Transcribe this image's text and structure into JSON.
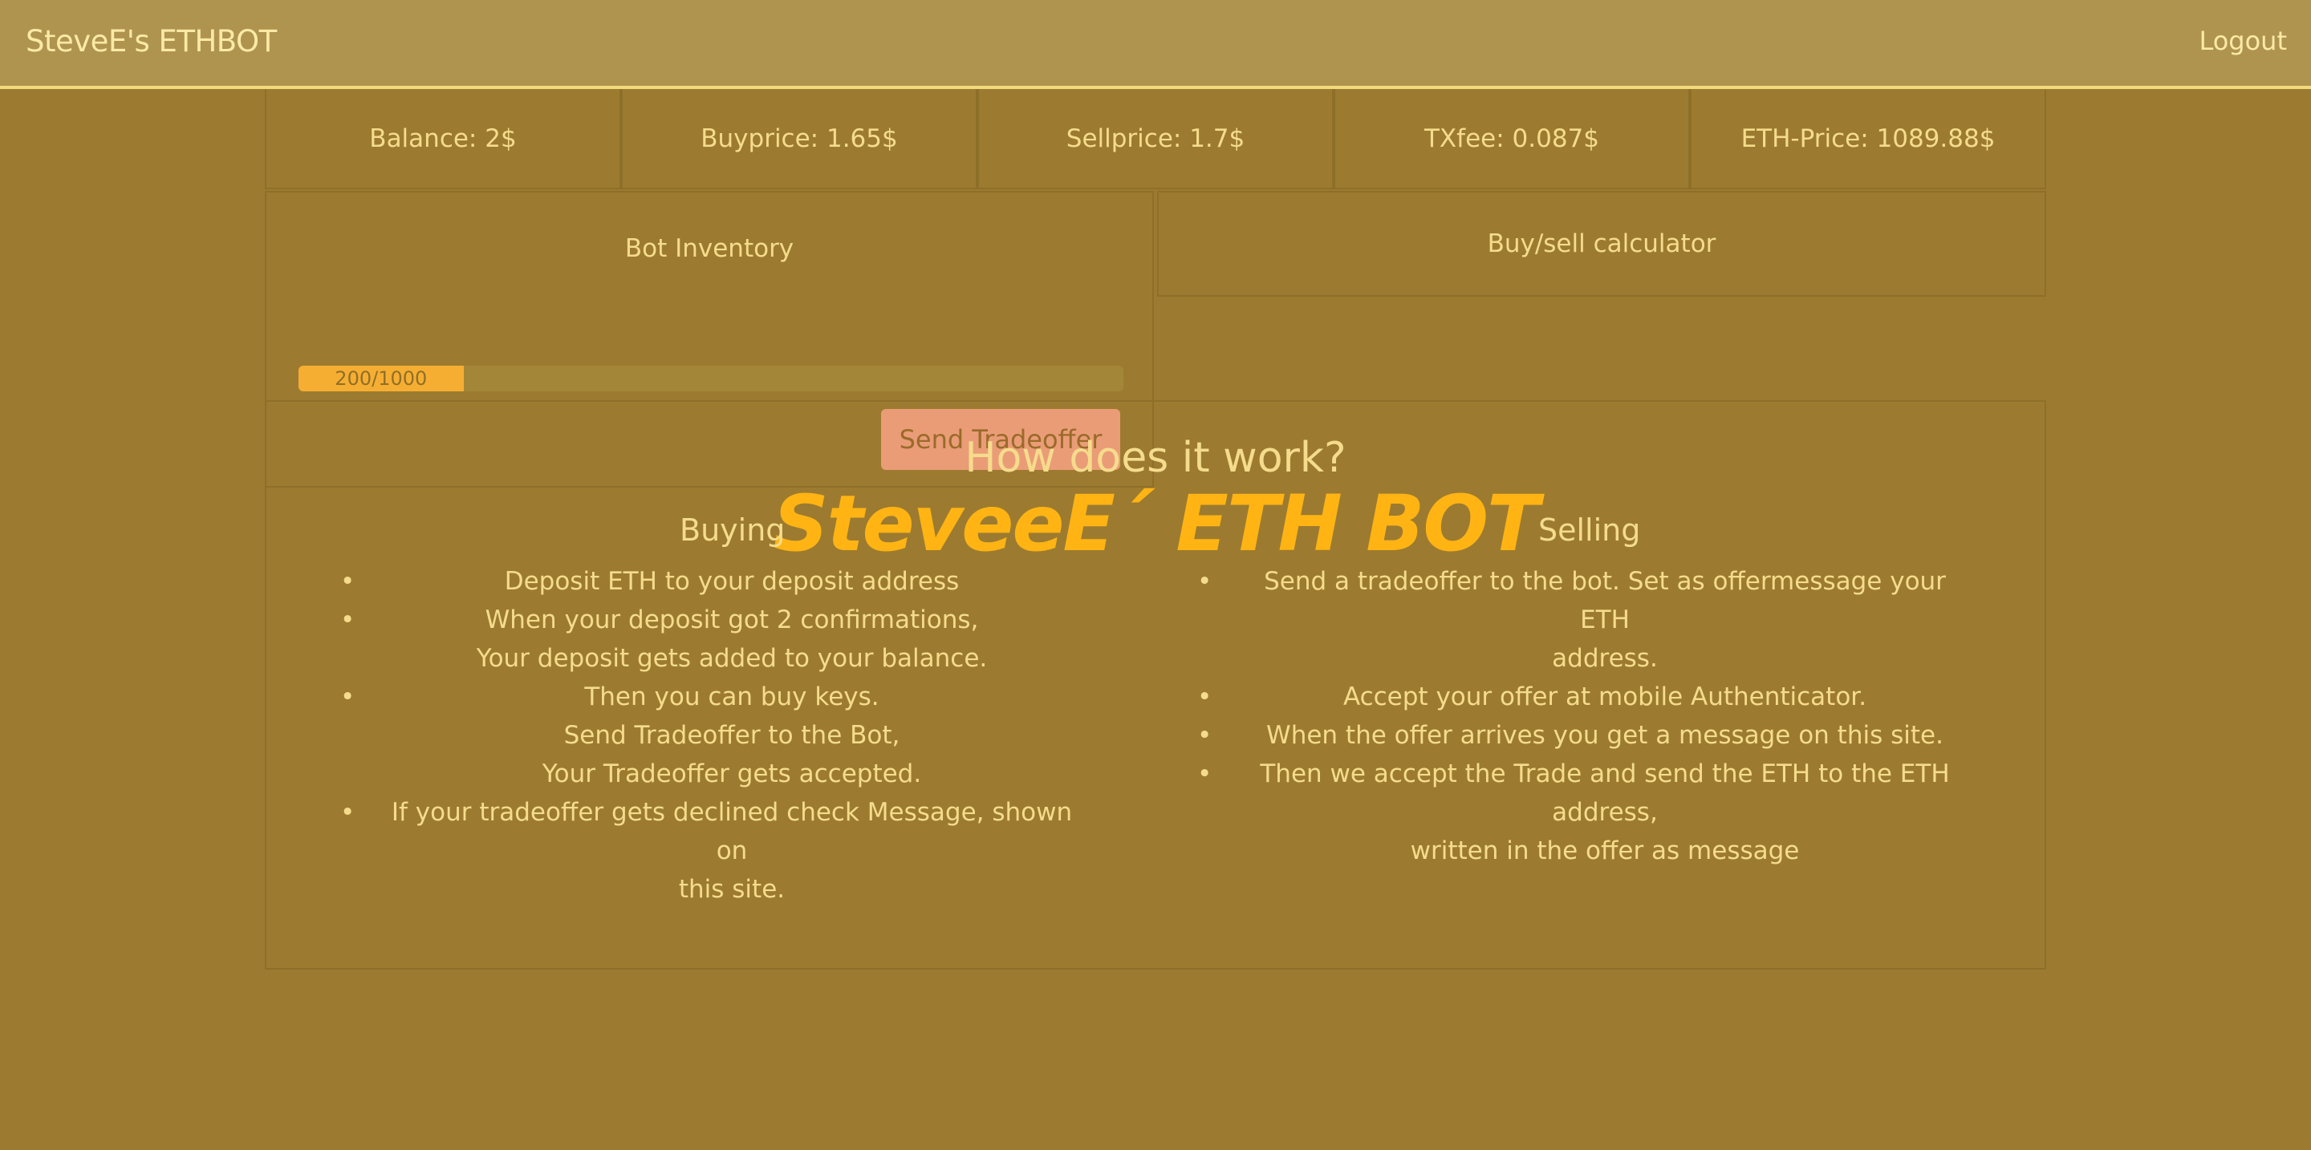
{
  "navbar": {
    "brand": "SteveE's ETHBOT",
    "logout": "Logout"
  },
  "stats": [
    {
      "label": "Balance: 2$"
    },
    {
      "label": "Buyprice: 1.65$"
    },
    {
      "label": "Sellprice: 1.7$"
    },
    {
      "label": "TXfee: 0.087$"
    },
    {
      "label": "ETH-Price: 1089.88$"
    }
  ],
  "inventory": {
    "title": "Bot Inventory",
    "progress_text": "200/1000",
    "progress_fraction": 0.2,
    "send_button": "Send Tradeoffer"
  },
  "calculator": {
    "title": "Buy/sell calculator"
  },
  "how": {
    "title": "How does it work?",
    "logo_text": "SteveeE´ ETH BOT",
    "buying_title": "Buying",
    "selling_title": "Selling",
    "buying_items": [
      [
        "Deposit ETH to your deposit address"
      ],
      [
        "When your deposit got 2 confirmations,",
        "Your deposit gets added to your balance."
      ],
      [
        "Then you can buy keys.",
        "Send Tradeoffer to the Bot,",
        "Your Tradeoffer gets accepted."
      ],
      [
        "If your tradeoffer gets declined check Message, shown on",
        "this site."
      ]
    ],
    "selling_items": [
      [
        "Send a tradeoffer to the bot. Set as offermessage your ETH",
        "address."
      ],
      [
        "Accept your offer at mobile Authenticator."
      ],
      [
        "When the offer arrives you get a message on this site."
      ],
      [
        "Then we accept the Trade and send the ETH to the ETH",
        "address,",
        "written in the offer as message"
      ]
    ]
  },
  "colors": {
    "background": "#9c7b30",
    "navbar": "#af944f",
    "navbar_border": "#f3da7d",
    "text": "#f5dc8c",
    "progress_fill": "#f6ae32",
    "button": "#ea9c77",
    "logo": "#ffb414"
  },
  "icons": {
    "bullet": "•"
  }
}
